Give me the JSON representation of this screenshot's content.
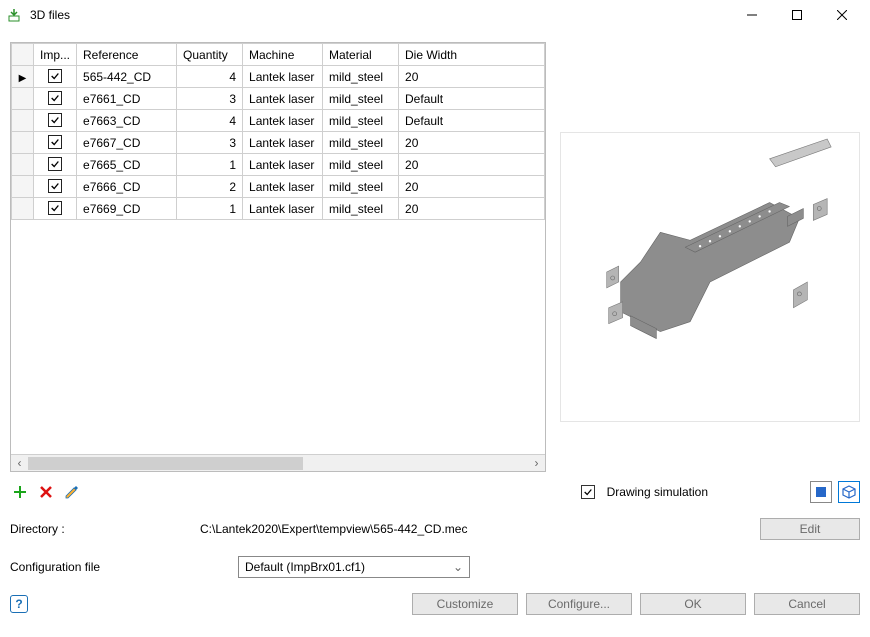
{
  "window_title": "3D files",
  "grid": {
    "columns": [
      "Imp...",
      "Reference",
      "Quantity",
      "Machine",
      "Material",
      "Die Width"
    ],
    "rows": [
      {
        "imp": true,
        "reference": "565-442_CD",
        "quantity": 4,
        "machine": "Lantek laser",
        "material": "mild_steel",
        "die_width": "20",
        "current": true
      },
      {
        "imp": true,
        "reference": "e7661_CD",
        "quantity": 3,
        "machine": "Lantek laser",
        "material": "mild_steel",
        "die_width": "Default",
        "current": false
      },
      {
        "imp": true,
        "reference": "e7663_CD",
        "quantity": 4,
        "machine": "Lantek laser",
        "material": "mild_steel",
        "die_width": "Default",
        "current": false
      },
      {
        "imp": true,
        "reference": "e7667_CD",
        "quantity": 3,
        "machine": "Lantek laser",
        "material": "mild_steel",
        "die_width": "20",
        "current": false
      },
      {
        "imp": true,
        "reference": "e7665_CD",
        "quantity": 1,
        "machine": "Lantek laser",
        "material": "mild_steel",
        "die_width": "20",
        "current": false
      },
      {
        "imp": true,
        "reference": "e7666_CD",
        "quantity": 2,
        "machine": "Lantek laser",
        "material": "mild_steel",
        "die_width": "20",
        "current": false
      },
      {
        "imp": true,
        "reference": "e7669_CD",
        "quantity": 1,
        "machine": "Lantek laser",
        "material": "mild_steel",
        "die_width": "20",
        "current": false
      }
    ]
  },
  "drawing_simulation": {
    "checked": true,
    "label": "Drawing simulation"
  },
  "directory": {
    "label": "Directory :",
    "path": "C:\\Lantek2020\\Expert\\tempview\\565-442_CD.mec"
  },
  "configuration": {
    "label": "Configuration file",
    "selected": "Default (ImpBrx01.cf1)"
  },
  "buttons": {
    "edit": "Edit",
    "customize": "Customize",
    "configure": "Configure...",
    "ok": "OK",
    "cancel": "Cancel"
  }
}
